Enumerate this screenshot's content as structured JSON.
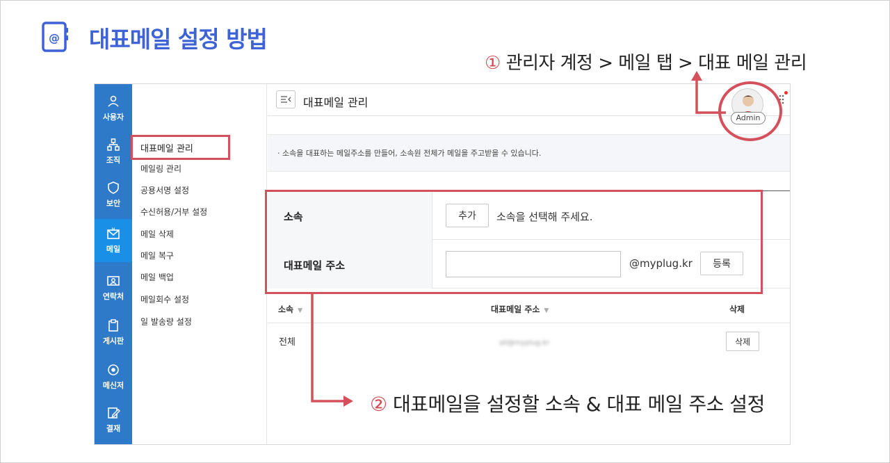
{
  "header": {
    "title": "대표메일 설정 방법",
    "title_icon": "address-book-at-icon",
    "accent_color": "#3d63d6"
  },
  "annotations": {
    "step1": {
      "number": "①",
      "text": " 관리자 계정 > 메일 탭 > 대표 메일 관리"
    },
    "step2": {
      "number": "②",
      "text": " 대표메일을 설정할 소속 & 대표 메일 주소 설정"
    },
    "highlight_color": "#d4505a"
  },
  "sidebar": {
    "items": [
      {
        "label": "사용자",
        "icon": "user-icon"
      },
      {
        "label": "조직",
        "icon": "org-chart-icon"
      },
      {
        "label": "보안",
        "icon": "shield-icon"
      },
      {
        "label": "메일",
        "icon": "mail-icon",
        "active": true
      },
      {
        "label": "연락처",
        "icon": "contact-card-icon"
      },
      {
        "label": "게시판",
        "icon": "clipboard-icon"
      },
      {
        "label": "메신저",
        "icon": "messenger-icon"
      },
      {
        "label": "결재",
        "icon": "approval-pen-icon"
      }
    ],
    "color": "#2f79c9"
  },
  "submenu": {
    "items": [
      "대표메일 관리",
      "메일링 관리",
      "공용서명 설정",
      "수신허용/거부 설정",
      "메일 삭제",
      "메일 복구",
      "메일 백업",
      "메일회수 설정",
      "일 발송량 설정"
    ]
  },
  "content": {
    "title": "대표메일 관리",
    "admin_label": "Admin",
    "info": "· 소속을 대표하는 메일주소를 만들어, 소속원 전체가 메일을 주고받을 수 있습니다.",
    "form": {
      "dept_label": "소속",
      "add_button": "추가",
      "dept_hint": "소속을 선택해 주세요.",
      "address_label": "대표메일 주소",
      "address_value": "",
      "domain": "@myplug.kr",
      "register_button": "등록"
    },
    "table": {
      "columns": [
        "소속",
        "대표메일 주소",
        "삭제"
      ],
      "rows": [
        {
          "dept": "전체",
          "address": "all@myplug.kr",
          "delete": "삭제"
        }
      ]
    }
  }
}
